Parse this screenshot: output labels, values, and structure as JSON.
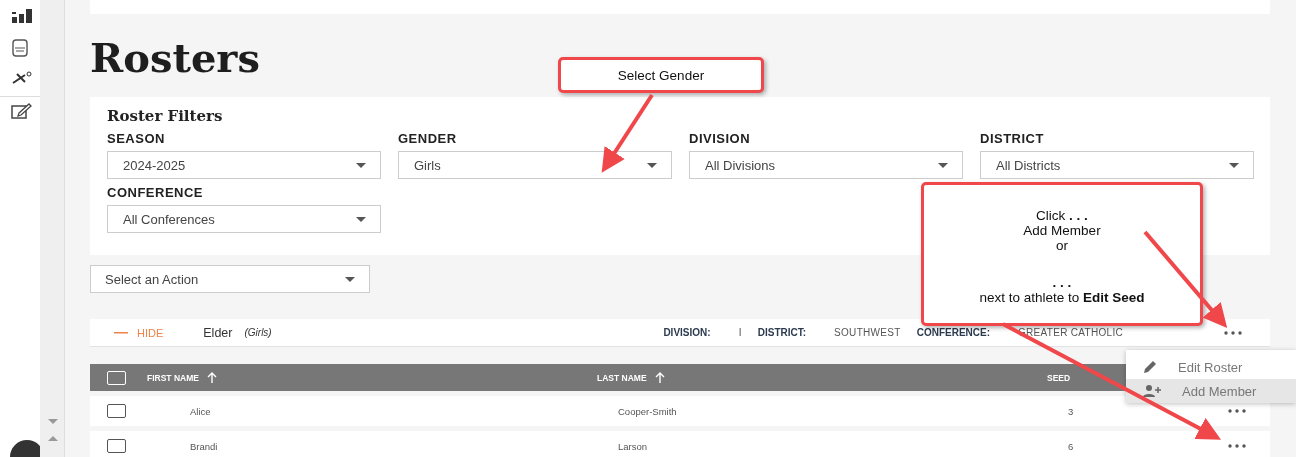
{
  "page": {
    "title": "Rosters"
  },
  "filters": {
    "title": "Roster Filters",
    "fields": [
      {
        "label": "SEASON",
        "value": "2024-2025"
      },
      {
        "label": "GENDER",
        "value": "Girls"
      },
      {
        "label": "DIVISION",
        "value": "All Divisions"
      },
      {
        "label": "DISTRICT",
        "value": "All Districts"
      },
      {
        "label": "CONFERENCE",
        "value": "All Conferences"
      }
    ]
  },
  "action_select": {
    "value": "Select an Action"
  },
  "roster": {
    "toggle": "HIDE",
    "name": "Elder",
    "gender": "(Girls)",
    "meta": [
      {
        "label": "DIVISION:",
        "value": "I"
      },
      {
        "label": "DISTRICT:",
        "value": "SOUTHWEST"
      },
      {
        "label": "CONFERENCE:",
        "value": "GREATER CATHOLIC"
      }
    ]
  },
  "menu": [
    {
      "label": "Edit Roster",
      "kind": "edit",
      "selected": false
    },
    {
      "label": "Add Member",
      "kind": "add",
      "selected": true
    }
  ],
  "table": {
    "select_all_checked": false,
    "columns": [
      {
        "label": "FIRST NAME",
        "sortable": true
      },
      {
        "label": "LAST NAME",
        "sortable": true
      },
      {
        "label": "SEED",
        "sortable": false
      }
    ],
    "rows": [
      {
        "first": "Alice",
        "last": "Cooper-Smith",
        "seed": "3",
        "checked": false
      },
      {
        "first": "Brandi",
        "last": "Larson",
        "seed": "6",
        "checked": false
      }
    ]
  },
  "callouts": [
    {
      "groups": [
        [
          "Select Gender"
        ]
      ]
    },
    {
      "groups": [
        [
          "Click **. . .**",
          "Add Member",
          "or"
        ],
        [
          "**. . .**",
          "next to athlete to **Edit Seed**"
        ]
      ]
    }
  ]
}
